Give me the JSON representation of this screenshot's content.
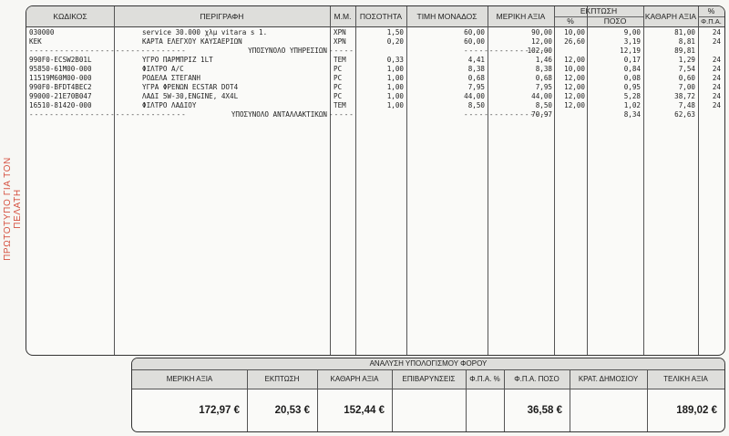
{
  "side_text": "ΠΡΩΤΟΤΥΠΟ ΓΙΑ ΤΟΝ ΠΕΛΑΤΗ",
  "columns": {
    "code": "ΚΩΔΙΚΟΣ",
    "description": "ΠΕΡΙΓΡΑΦΗ",
    "unit": "Μ.Μ.",
    "qty": "ΠΟΣΟΤΗΤΑ",
    "unit_price": "ΤΙΜΗ ΜΟΝΑΔΟΣ",
    "partial_value": "ΜΕΡΙΚΗ ΑΞΙΑ",
    "discount": "ΕΚΠΤΩΣΗ",
    "discount_pct": "%",
    "discount_amount": "ΠΟΣΟ",
    "net_value": "ΚΑΘΑΡΗ ΑΞΙΑ",
    "vat_pct": "%",
    "vat_label": "Φ.Π.Α."
  },
  "rows": [
    {
      "code": "030000",
      "description": "service 30.000 χλμ vitara s 1.",
      "unit": "ΧΡΝ",
      "qty": "1,50",
      "unit_price": "60,00",
      "partial": "90,00",
      "disc_pct": "10,00",
      "disc_amt": "9,00",
      "net": "81,00",
      "vat": "24"
    },
    {
      "code": "ΚΕΚ",
      "description": "ΚΑΡΤΑ ΕΛΕΓΧΟΥ ΚΑΥΣΑΕΡΙΩΝ",
      "unit": "ΧΡΝ",
      "qty": "0,20",
      "unit_price": "60,00",
      "partial": "12,00",
      "disc_pct": "26,60",
      "disc_amt": "3,19",
      "net": "8,81",
      "vat": "24"
    },
    {
      "subtotal": true,
      "label": "ΥΠΟΣΥΝΟΛΟ ΥΠΗΡΕΣΙΩΝ",
      "partial": "102,00",
      "disc_amt": "12,19",
      "net": "89,81"
    },
    {
      "code": "990F0-ECSW2B01L",
      "description": "ΥΓΡΟ ΠΑΡΜΠΡΙΖ 1LT",
      "unit": "ΤΕΜ",
      "qty": "0,33",
      "unit_price": "4,41",
      "partial": "1,46",
      "disc_pct": "12,00",
      "disc_amt": "0,17",
      "net": "1,29",
      "vat": "24"
    },
    {
      "code": "95850-61M00-000",
      "description": "ΦΙΛΤΡΟ A/C",
      "unit": "PC",
      "qty": "1,00",
      "unit_price": "8,38",
      "partial": "8,38",
      "disc_pct": "10,00",
      "disc_amt": "0,84",
      "net": "7,54",
      "vat": "24"
    },
    {
      "code": "11519M60M00-000",
      "description": "ΡΟΔΕΛΑ ΣΤΕΓΑΝΗ",
      "unit": "PC",
      "qty": "1,00",
      "unit_price": "0,68",
      "partial": "0,68",
      "disc_pct": "12,00",
      "disc_amt": "0,08",
      "net": "0,60",
      "vat": "24"
    },
    {
      "code": "990F0-BFDT4BEC2",
      "description": "ΥΓΡΑ ΦΡΕΝΩΝ ECSTAR DOT4",
      "unit": "PC",
      "qty": "1,00",
      "unit_price": "7,95",
      "partial": "7,95",
      "disc_pct": "12,00",
      "disc_amt": "0,95",
      "net": "7,00",
      "vat": "24"
    },
    {
      "code": "99000-21E70B047",
      "description": "ΛΑΔΙ 5W-30,ENGINE, 4X4L",
      "unit": "PC",
      "qty": "1,00",
      "unit_price": "44,00",
      "partial": "44,00",
      "disc_pct": "12,00",
      "disc_amt": "5,28",
      "net": "38,72",
      "vat": "24"
    },
    {
      "code": "16510-81420-000",
      "description": "ΦΙΛΤΡΟ ΛΑΔΙΟΥ",
      "unit": "ΤΕΜ",
      "qty": "1,00",
      "unit_price": "8,50",
      "partial": "8,50",
      "disc_pct": "12,00",
      "disc_amt": "1,02",
      "net": "7,48",
      "vat": "24"
    },
    {
      "subtotal": true,
      "label": "ΥΠΟΣΥΝΟΛΟ ΑΝΤΑΛΛΑΚΤΙΚΩΝ",
      "partial": "70,97",
      "disc_amt": "8,34",
      "net": "62,63"
    }
  ],
  "tax_box": {
    "title": "ΑΝΑΛΥΣΗ ΥΠΟΛΟΓΙΣΜΟΥ ΦΟΡΟΥ",
    "headers": [
      "ΜΕΡΙΚΗ ΑΞΙΑ",
      "ΕΚΠΤΩΣΗ",
      "ΚΑΘΑΡΗ ΑΞΙΑ",
      "ΕΠΙΒΑΡΥΝΣΕΙΣ",
      "Φ.Π.Α. %",
      "Φ.Π.Α. ΠΟΣΟ",
      "ΚΡΑΤ. ΔΗΜΟΣΙΟΥ",
      "ΤΕΛΙΚΗ ΑΞΙΑ"
    ],
    "values": [
      "172,97 €",
      "20,53 €",
      "152,44 €",
      "",
      "",
      "36,58 €",
      "",
      "189,02 €"
    ]
  }
}
